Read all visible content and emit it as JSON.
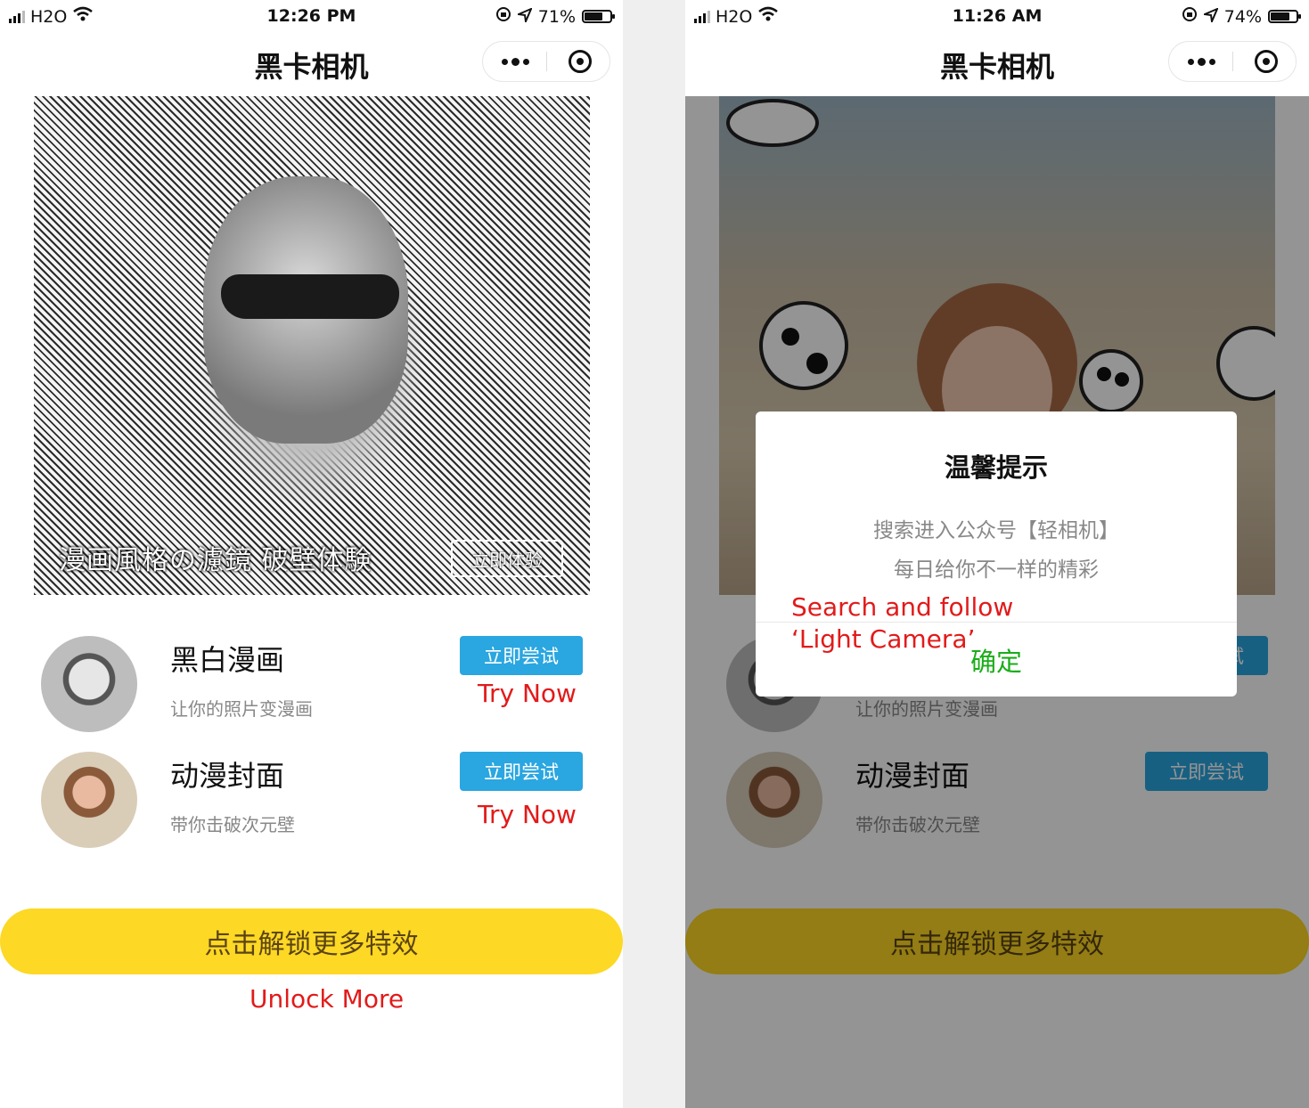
{
  "left": {
    "status": {
      "carrier": "H2O",
      "time": "12:26 PM",
      "battery": "71%",
      "battery_level": 0.71
    },
    "nav": {
      "title": "黑卡相机"
    },
    "hero": {
      "caption": "漫画風格の濾鏡 破壁体験",
      "button": "立即体验"
    },
    "items": [
      {
        "title": "黑白漫画",
        "subtitle": "让你的照片变漫画",
        "button": "立即尝试",
        "annotation": "Try Now"
      },
      {
        "title": "动漫封面",
        "subtitle": "带你击破次元壁",
        "button": "立即尝试",
        "annotation": "Try Now"
      }
    ],
    "unlock": {
      "label": "点击解锁更多特效",
      "annotation": "Unlock More"
    }
  },
  "right": {
    "status": {
      "carrier": "H2O",
      "time": "11:26 AM",
      "battery": "74%",
      "battery_level": 0.74
    },
    "nav": {
      "title": "黑卡相机"
    },
    "items": [
      {
        "subtitle": "让你的照片变漫画",
        "button": "立即尝试"
      },
      {
        "title": "动漫封面",
        "subtitle": "带你击破次元壁",
        "button": "立即尝试"
      }
    ],
    "unlock": {
      "label": "点击解锁更多特效"
    },
    "dialog": {
      "title": "温馨提示",
      "line1": "搜索进入公众号【轻相机】",
      "line2": "每日给你不一样的精彩",
      "confirm": "确定",
      "annotation": "Search and follow ‘Light Camera’"
    }
  },
  "colors": {
    "accent_blue": "#2aa6e0",
    "unlock_yellow": "#fdd824",
    "annotation_red": "#e21a1a",
    "confirm_green": "#1aad19"
  }
}
